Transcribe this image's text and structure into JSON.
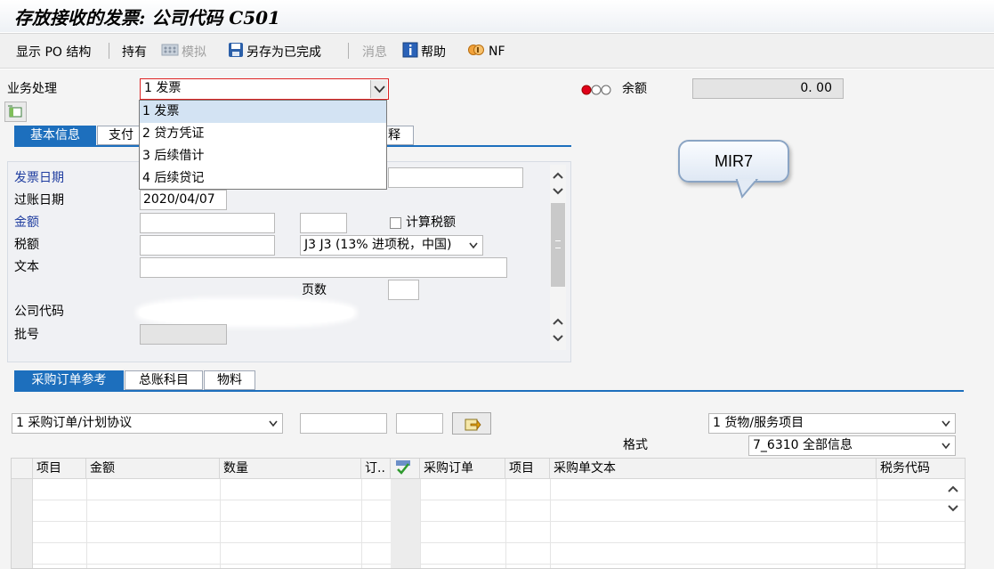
{
  "window": {
    "title": "存放接收的发票: 公司代码 C501"
  },
  "toolbar": {
    "show_po": "显示 PO 结构",
    "hold": "持有",
    "simulate": "模拟",
    "save_completed": "另存为已完成",
    "messages": "消息",
    "help": "帮助",
    "nf": "NF"
  },
  "header": {
    "transaction_label": "业务处理",
    "transaction_value": "1 发票",
    "transaction_options": [
      "1 发票",
      "2 贷方凭证",
      "3 后续借计",
      "4 后续贷记"
    ],
    "balance_label": "余额",
    "balance_value": "0. 00"
  },
  "top_tabs": [
    "基本信息",
    "支付",
    "释"
  ],
  "basic": {
    "invoice_date_label": "发票日期",
    "posting_date_label": "过账日期",
    "posting_date_value": "2020/04/07",
    "amount_label": "金额",
    "calc_tax_label": "计算税额",
    "tax_amount_label": "税额",
    "tax_code_value": "J3 J3 (13% 进项税，中国)",
    "text_label": "文本",
    "pages_label": "页数",
    "company_code_label": "公司代码",
    "batch_label": "批号"
  },
  "bubble": {
    "text": "MIR7"
  },
  "bottom_tabs": [
    "采购订单参考",
    "总账科目",
    "物料"
  ],
  "po_ref": {
    "ref_type_value": "1 采购订单/计划协议",
    "item_type_value": "1 货物/服务项目",
    "layout_label": "格式",
    "layout_value": "7_6310 全部信息"
  },
  "grid": {
    "columns": [
      "项目",
      "金额",
      "数量",
      "订..",
      "",
      "采购订单",
      "项目",
      "采购单文本",
      "税务代码"
    ]
  },
  "colors": {
    "accent": "#1d6fbd",
    "label_blue": "#1f3da0",
    "status_red": "#e0001a"
  }
}
